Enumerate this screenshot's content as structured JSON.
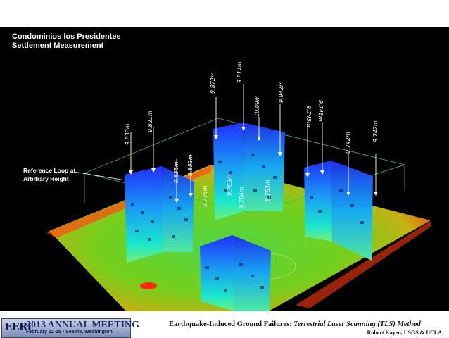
{
  "slide": {
    "title_line1": "Condominios los Presidentes",
    "title_line2": "Settlement Measurement",
    "ref_line1": "Reference Loop at",
    "ref_line2": "Arbitrary Height"
  },
  "measurements": [
    "9.833m",
    "9.821m",
    "9.835m",
    "9.852m",
    "9.872m",
    "9.814m",
    "10.09m",
    "9.942m",
    "9.745m",
    "9.748m",
    "9.742m",
    "9.742m",
    "9.765m",
    "9.763m",
    "9.775m",
    "9.784m"
  ],
  "footer": {
    "logo_eeri": "EERI",
    "logo_meeting": "2013 ANNUAL MEETING",
    "logo_dates": "February 12-15 • Seattle, Washington",
    "title_bold": "Earthquake-Induced Ground Failures:",
    "title_italic": "Terrestrial Laser Scanning (TLS) Method",
    "author": "Robert Kayen, USGS & UCLA"
  },
  "colors": {
    "background": "#000000",
    "footer": "#ffffff",
    "point_cloud_top": "#1f3cff",
    "point_cloud_mid": "#19e0d8",
    "point_cloud_base": "#9ae017",
    "ground_hot": "#ff3a10"
  }
}
